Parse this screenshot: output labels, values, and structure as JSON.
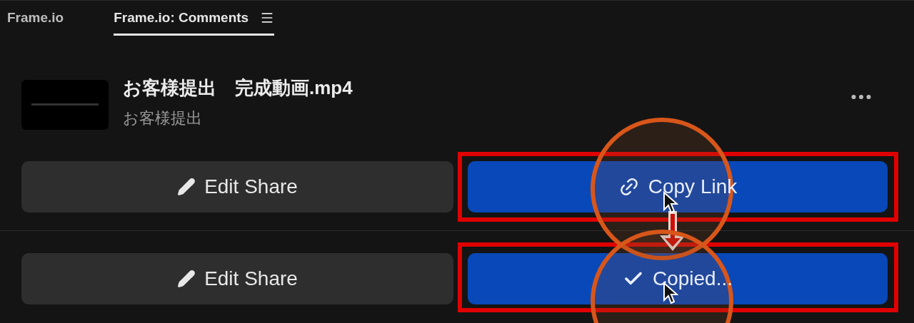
{
  "tabs": [
    {
      "label": "Frame.io",
      "selected": false
    },
    {
      "label": "Frame.io: Comments",
      "selected": true
    }
  ],
  "file": {
    "title": "お客様提出　完成動画.mp4",
    "subtitle": "お客様提出"
  },
  "share_rows": [
    {
      "edit_label": "Edit Share",
      "action": {
        "kind": "link",
        "label": "Copy Link"
      }
    },
    {
      "edit_label": "Edit Share",
      "action": {
        "kind": "copied",
        "label": "Copied..."
      }
    }
  ]
}
